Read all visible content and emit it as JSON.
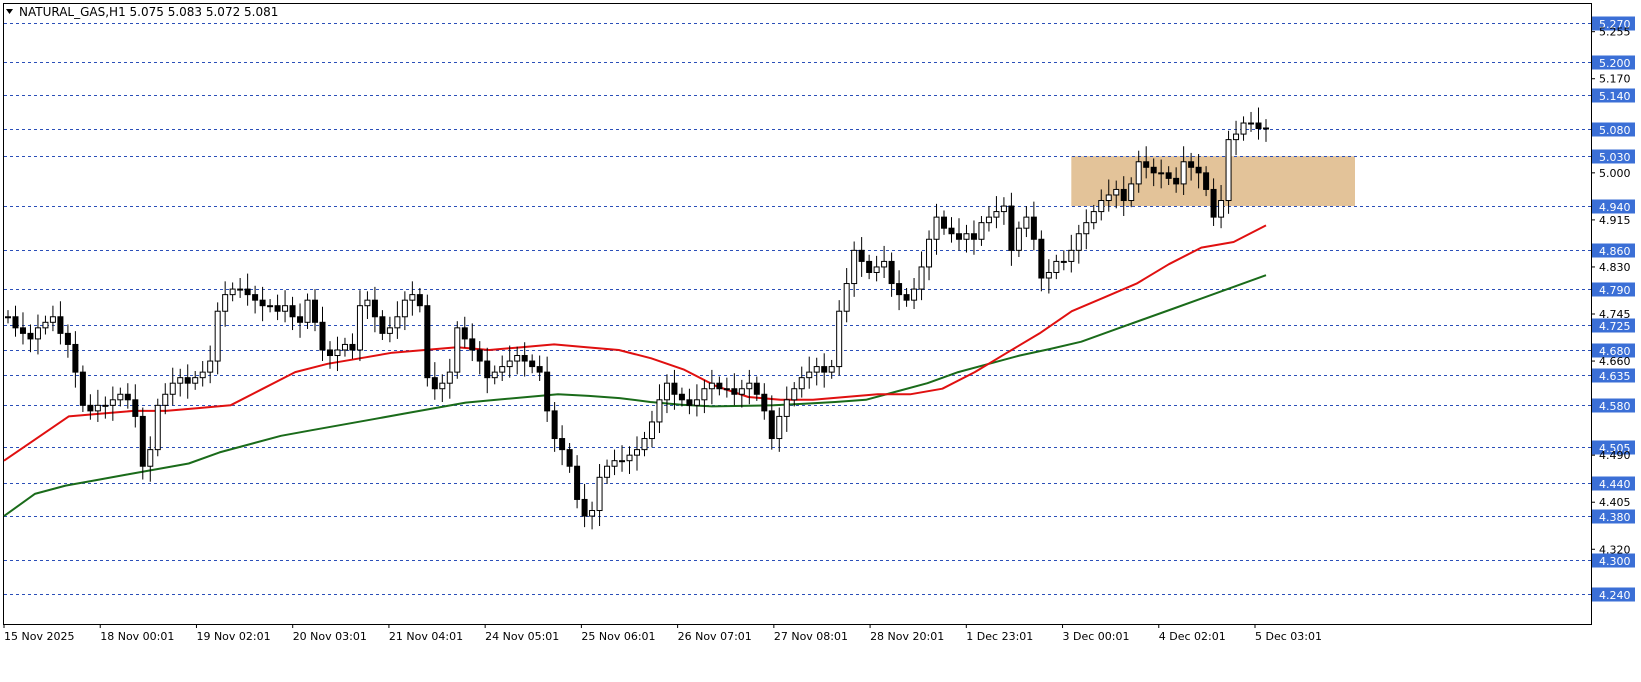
{
  "header": {
    "symbol_line": "NATURAL_GAS,H1  5.075 5.083 5.072 5.081",
    "menu_icon": "triangle-down-icon"
  },
  "chart_data": {
    "type": "candlestick",
    "symbol": "NATURAL_GAS",
    "timeframe": "H1",
    "ohlc_last": {
      "open": 5.075,
      "high": 5.083,
      "low": 5.072,
      "close": 5.081
    },
    "ylim": [
      4.185,
      5.305
    ],
    "y_ticks": [
      "5.255",
      "5.170",
      "5.000",
      "4.915",
      "4.830",
      "4.745",
      "4.660",
      "4.490",
      "4.405",
      "4.320"
    ],
    "y_tick_values": [
      5.255,
      5.17,
      5.0,
      4.915,
      4.83,
      4.745,
      4.66,
      4.49,
      4.405,
      4.32
    ],
    "levels": [
      5.27,
      5.2,
      5.14,
      5.08,
      5.03,
      4.94,
      4.86,
      4.79,
      4.725,
      4.68,
      4.635,
      4.58,
      4.505,
      4.44,
      4.38,
      4.3,
      4.24
    ],
    "level_labels": [
      "5.270",
      "5.200",
      "5.140",
      "5.080",
      "5.030",
      "4.940",
      "4.860",
      "4.790",
      "4.725",
      "4.680",
      "4.635",
      "4.580",
      "4.505",
      "4.440",
      "4.380",
      "4.300",
      "4.240"
    ],
    "level_colors": {
      "line": "#2b4fb8",
      "label_bg": "#3b6fd6",
      "label_text": "#ffffff"
    },
    "x_labels": [
      "15 Nov 2025",
      "18 Nov 00:01",
      "19 Nov 02:01",
      "20 Nov 03:01",
      "21 Nov 04:01",
      "24 Nov 05:01",
      "25 Nov 06:01",
      "26 Nov 07:01",
      "27 Nov 08:01",
      "28 Nov 20:01",
      "1 Dec 23:01",
      "3 Dec 00:01",
      "4 Dec 02:01",
      "5 Dec 03:01"
    ],
    "zone": {
      "top": 5.03,
      "bottom": 4.94,
      "color": "#deb887"
    },
    "close_series": [
      4.74,
      4.72,
      4.71,
      4.7,
      4.72,
      4.73,
      4.74,
      4.71,
      4.69,
      4.64,
      4.58,
      4.57,
      4.58,
      4.58,
      4.59,
      4.6,
      4.59,
      4.56,
      4.47,
      4.5,
      4.58,
      4.6,
      4.62,
      4.63,
      4.62,
      4.63,
      4.64,
      4.66,
      4.75,
      4.78,
      4.79,
      4.79,
      4.78,
      4.77,
      4.76,
      4.76,
      4.75,
      4.76,
      4.74,
      4.73,
      4.77,
      4.73,
      4.68,
      4.67,
      4.68,
      4.69,
      4.68,
      4.76,
      4.77,
      4.74,
      4.71,
      4.72,
      4.74,
      4.77,
      4.78,
      4.76,
      4.63,
      4.61,
      4.62,
      4.64,
      4.72,
      4.7,
      4.68,
      4.66,
      4.63,
      4.64,
      4.65,
      4.66,
      4.67,
      4.66,
      4.65,
      4.64,
      4.57,
      4.52,
      4.5,
      4.47,
      4.41,
      4.38,
      4.39,
      4.45,
      4.47,
      4.48,
      4.48,
      4.49,
      4.5,
      4.52,
      4.55,
      4.59,
      4.62,
      4.6,
      4.59,
      4.58,
      4.59,
      4.61,
      4.62,
      4.61,
      4.61,
      4.6,
      4.61,
      4.62,
      4.6,
      4.57,
      4.52,
      4.56,
      4.59,
      4.61,
      4.63,
      4.64,
      4.65,
      4.64,
      4.65,
      4.75,
      4.8,
      4.86,
      4.84,
      4.82,
      4.83,
      4.84,
      4.8,
      4.78,
      4.77,
      4.79,
      4.83,
      4.88,
      4.92,
      4.9,
      4.89,
      4.88,
      4.89,
      4.88,
      4.91,
      4.92,
      4.93,
      4.94,
      4.86,
      4.9,
      4.92,
      4.88,
      4.81,
      4.82,
      4.84,
      4.84,
      4.86,
      4.89,
      4.91,
      4.93,
      4.95,
      4.96,
      4.97,
      4.95,
      4.98,
      5.02,
      5.01,
      5.0,
      5.0,
      4.99,
      4.98,
      5.02,
      5.01,
      5.0,
      4.97,
      4.92,
      4.95,
      5.06,
      5.07,
      5.09,
      5.09,
      5.08,
      5.081
    ],
    "ma_fast": {
      "color": "#e01010",
      "values": [
        4.48,
        4.52,
        4.56,
        4.565,
        4.57,
        4.57,
        4.575,
        4.58,
        4.61,
        4.64,
        4.655,
        4.665,
        4.675,
        4.68,
        4.685,
        4.68,
        4.685,
        4.69,
        4.685,
        4.68,
        4.665,
        4.645,
        4.615,
        4.595,
        4.59,
        4.59,
        4.595,
        4.6,
        4.6,
        4.61,
        4.64,
        4.675,
        4.71,
        4.75,
        4.775,
        4.8,
        4.835,
        4.865,
        4.875,
        4.905
      ]
    },
    "ma_slow": {
      "color": "#1a6b1a",
      "values": [
        4.38,
        4.42,
        4.435,
        4.445,
        4.455,
        4.465,
        4.475,
        4.495,
        4.51,
        4.525,
        4.535,
        4.545,
        4.555,
        4.565,
        4.575,
        4.585,
        4.59,
        4.595,
        4.6,
        4.597,
        4.593,
        4.586,
        4.581,
        4.578,
        4.579,
        4.58,
        4.583,
        4.586,
        4.59,
        4.605,
        4.62,
        4.64,
        4.655,
        4.67,
        4.682,
        4.695,
        4.715,
        4.735,
        4.755,
        4.775,
        4.795,
        4.815
      ]
    }
  }
}
